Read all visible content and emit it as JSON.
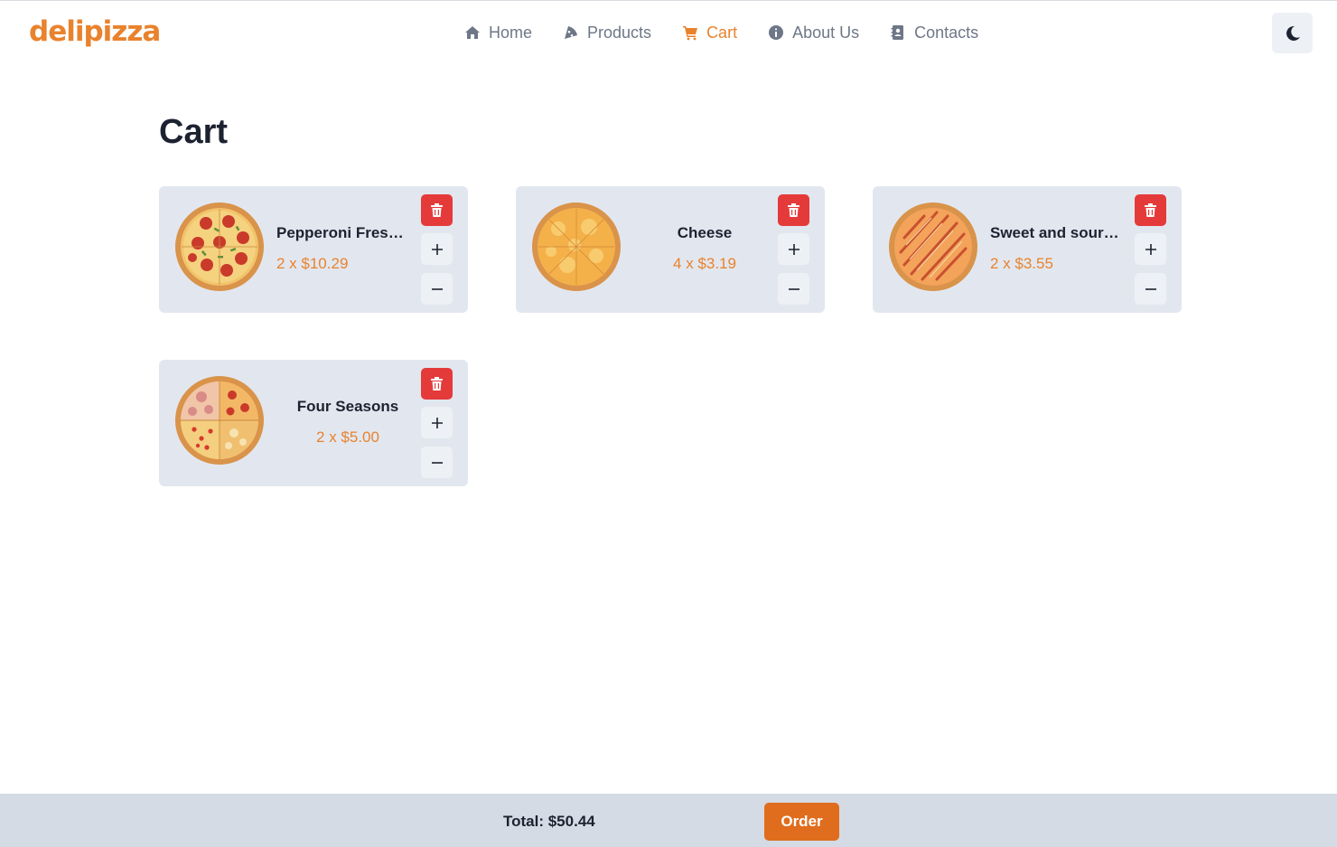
{
  "brand": {
    "logo_text": "delipizza",
    "color": "#e9822d"
  },
  "nav": {
    "items": [
      {
        "label": "Home",
        "icon": "home-icon"
      },
      {
        "label": "Products",
        "icon": "pizza-slice-icon"
      },
      {
        "label": "Cart",
        "icon": "cart-icon",
        "active": true
      },
      {
        "label": "About Us",
        "icon": "info-icon"
      },
      {
        "label": "Contacts",
        "icon": "contact-book-icon"
      }
    ],
    "theme_toggle_icon": "moon-icon"
  },
  "page": {
    "title": "Cart"
  },
  "cart": {
    "items": [
      {
        "name": "Pepperoni Fres…",
        "price": "2 x $10.29",
        "pizza": "pepperoni"
      },
      {
        "name": "Cheese",
        "price": "4 x $3.19",
        "pizza": "cheese"
      },
      {
        "name": "Sweet and sour…",
        "price": "2 x $3.55",
        "pizza": "sweet-sour"
      },
      {
        "name": "Four Seasons",
        "price": "2 x $5.00",
        "pizza": "four-seasons"
      }
    ]
  },
  "footer": {
    "total": "Total: $50.44",
    "order_label": "Order"
  },
  "colors": {
    "accent": "#e9822d",
    "delete": "#e53a3a",
    "order": "#e06d1d",
    "card": "#e2e7ef",
    "footer": "#d4dbe4"
  }
}
